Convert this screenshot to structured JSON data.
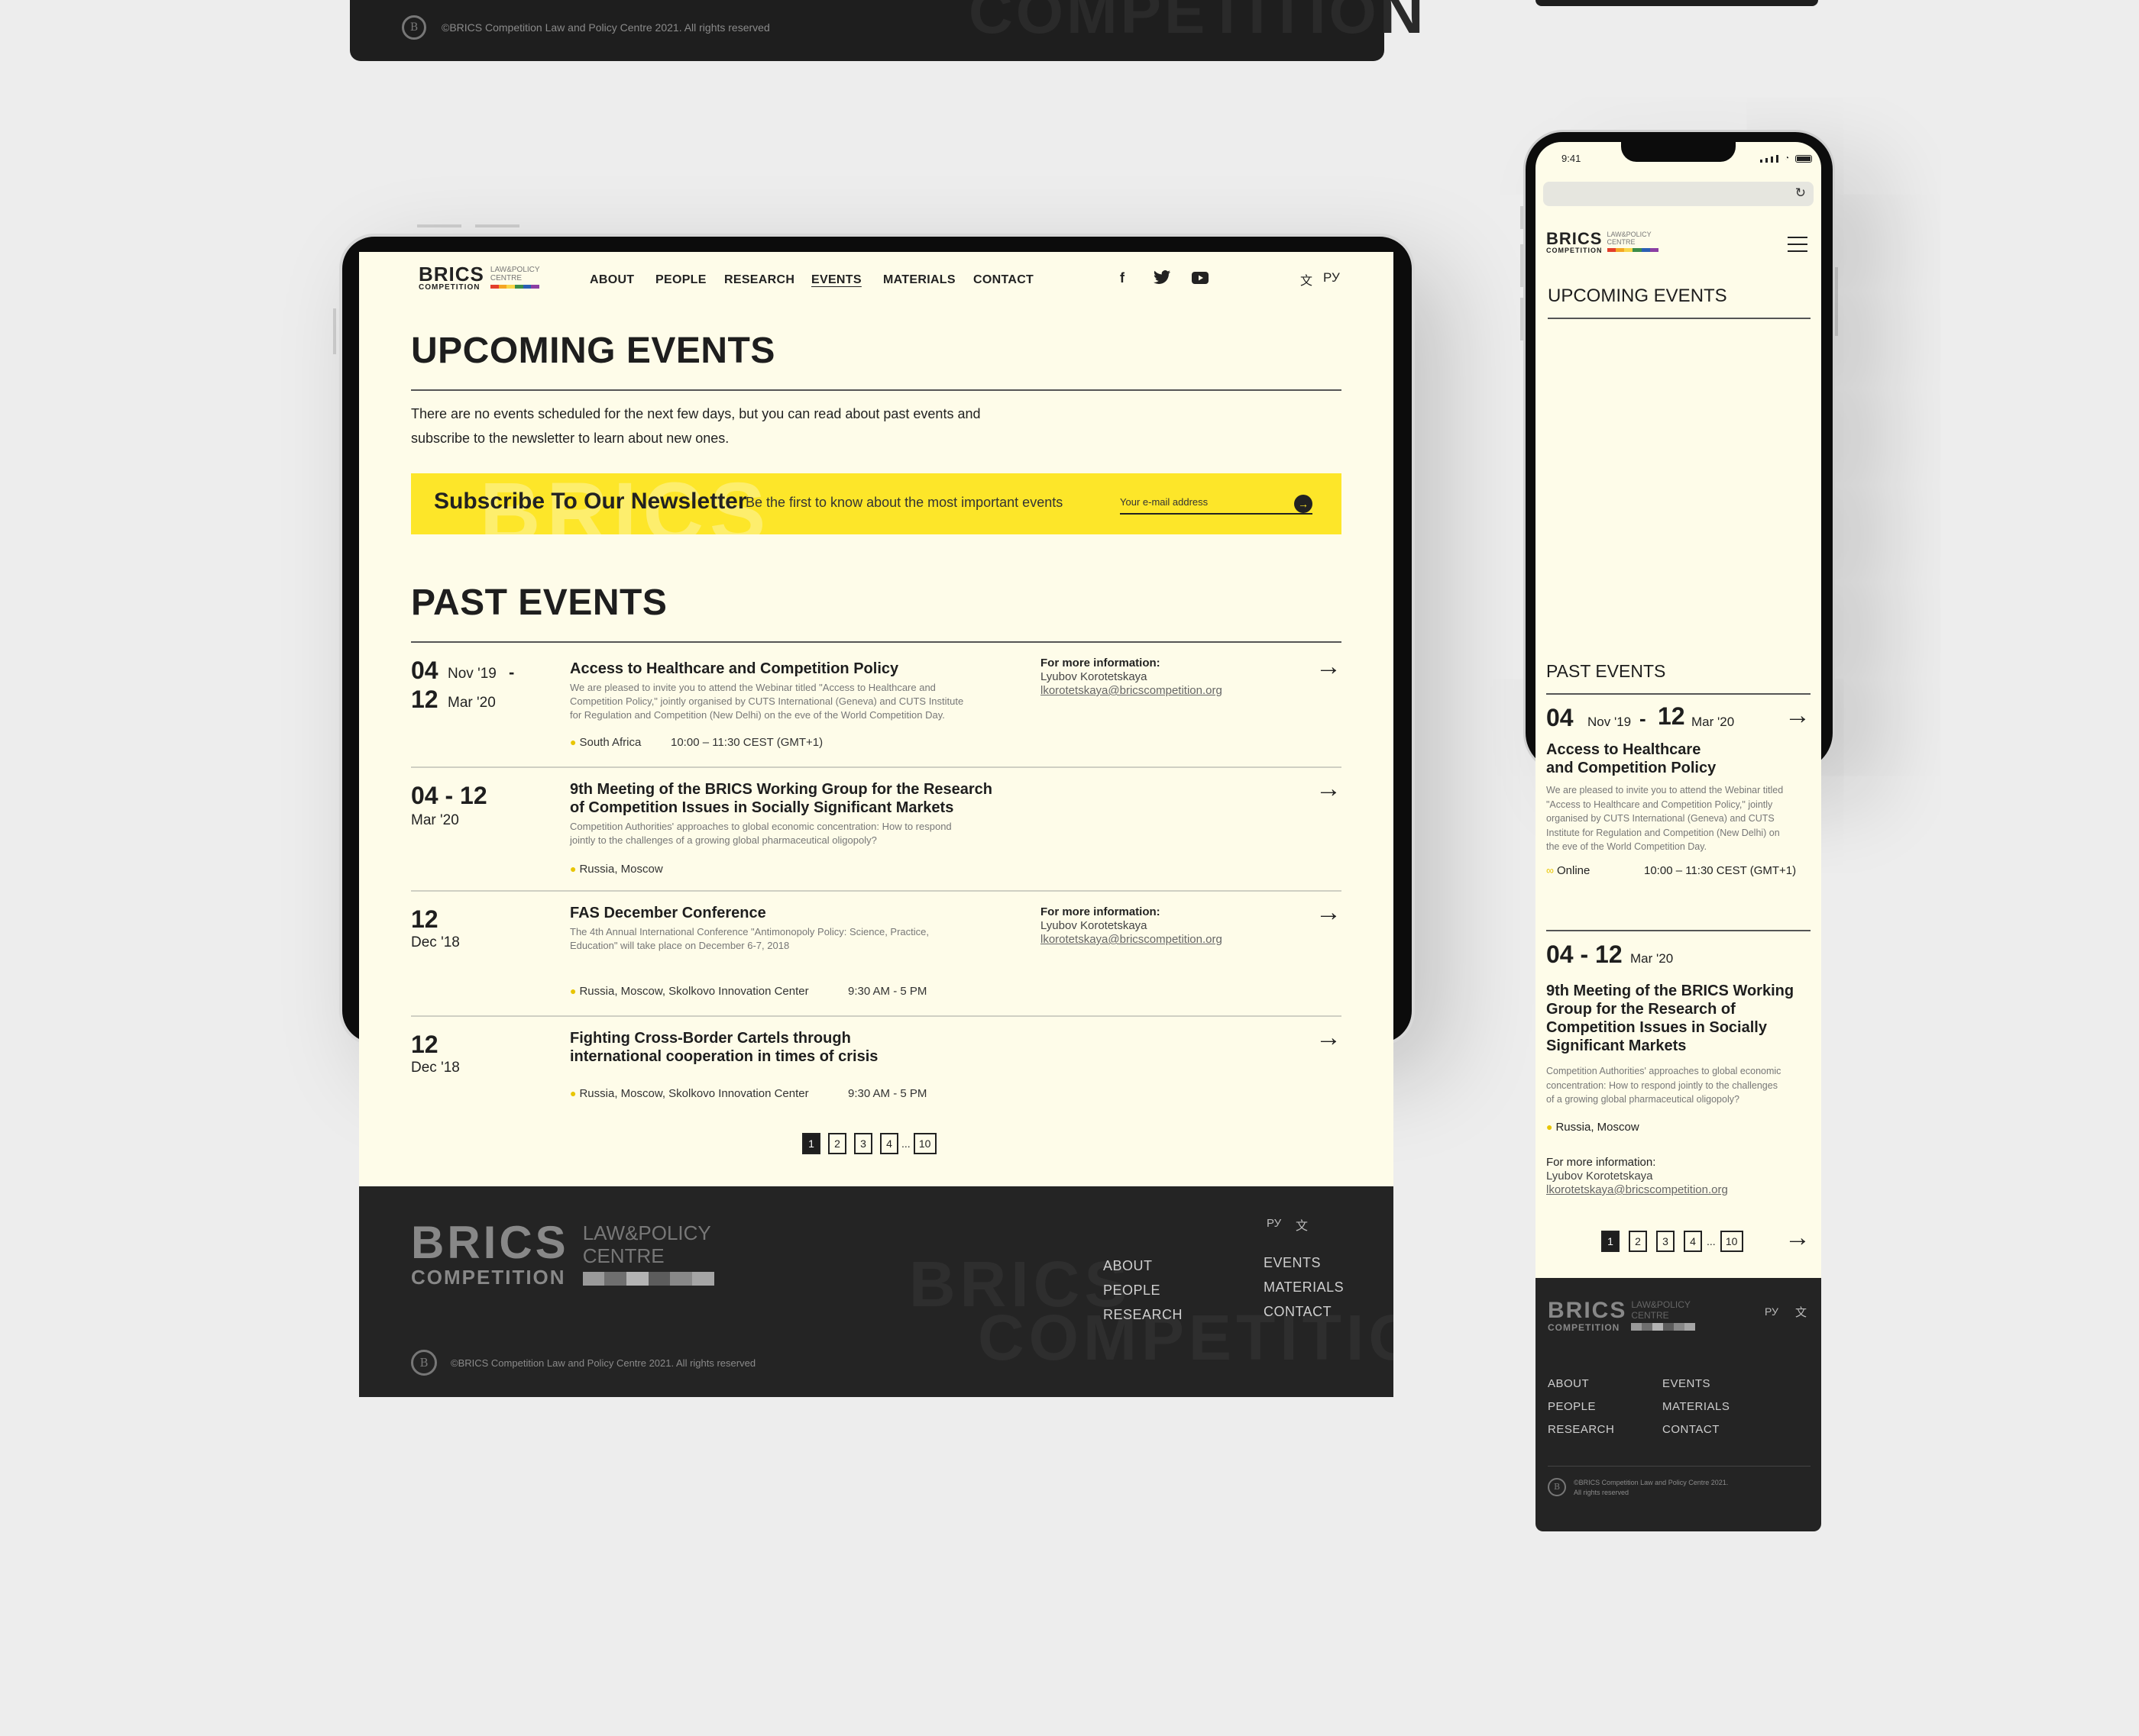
{
  "brand": {
    "name": "BRICS",
    "sub": "COMPETITION",
    "centre": [
      "LAW&POLICY",
      "CENTRE"
    ],
    "stripe_colors": [
      "#e33e2b",
      "#f5a623",
      "#f8d648",
      "#3b8c4a",
      "#2b5fb4",
      "#8b3fa3"
    ],
    "accent": "#fde629",
    "cream": "#fefce9",
    "dark": "#242424"
  },
  "nav": {
    "items": [
      "ABOUT",
      "PEOPLE",
      "RESEARCH",
      "EVENTS",
      "MATERIALS",
      "CONTACT"
    ],
    "active": "EVENTS",
    "lang": "РУ",
    "lang_icon": "文"
  },
  "upcoming": {
    "title": "UPCOMING EVENTS",
    "intro_line1": "There are no events scheduled for the next few days, but you can read about past events and",
    "intro_line2": "subscribe to the newsletter to learn about new ones."
  },
  "newsletter": {
    "watermark": "BRICS",
    "title": "Subscribe To Our Newsletter",
    "subtitle": "Be the first to know about the most important events",
    "placeholder": "Your e-mail address"
  },
  "past": {
    "title": "PAST EVENTS",
    "events": [
      {
        "day1": "04",
        "mon1": "Nov '19",
        "dash": "-",
        "day2": "12",
        "mon2": "Mar '20",
        "title": "Access to Healthcare and Competition Policy",
        "desc1": "We are pleased to invite you to attend the Webinar titled \"Access to Healthcare and",
        "desc2": "Competition Policy,\" jointly organised by CUTS International (Geneva) and CUTS Institute",
        "desc3": "for Regulation and Competition (New Delhi) on the eve of the World Competition Day.",
        "location": "South Africa",
        "time": "10:00 – 11:30 CEST (GMT+1)",
        "info_label": "For more information:",
        "info_name": "Lyubov Korotetskaya",
        "info_mail": "lkorotetskaya@bricscompetition.org"
      },
      {
        "range": "04 - 12",
        "mon": "Mar '20",
        "title1": "9th Meeting of the BRICS Working Group for the Research",
        "title2": "of Competition Issues in Socially Significant Markets",
        "desc1": "Competition Authorities' approaches to global economic concentration: How to respond",
        "desc2": "jointly to the challenges of a growing global pharmaceutical oligopoly?",
        "location": "Russia, Moscow"
      },
      {
        "day": "12",
        "mon": "Dec '18",
        "title": "FAS December Conference",
        "desc1": "The 4th Annual International Conference \"Antimonopoly Policy: Science, Practice,",
        "desc2": "Education\" will take place on December 6-7, 2018",
        "location": "Russia, Moscow, Skolkovo Innovation Center",
        "time": "9:30 AM - 5 PM",
        "info_label": "For more information:",
        "info_name": "Lyubov Korotetskaya",
        "info_mail": "lkorotetskaya@bricscompetition.org"
      },
      {
        "day": "12",
        "mon": "Dec '18",
        "title1": "Fighting Cross-Border Cartels through",
        "title2": "international cooperation in times of crisis",
        "location": "Russia, Moscow, Skolkovo Innovation Center",
        "time": "9:30 AM - 5 PM"
      }
    ],
    "pages": [
      "1",
      "2",
      "3",
      "4",
      "10"
    ],
    "ellipsis": "...",
    "current_page": "1"
  },
  "footer": {
    "links_col1": [
      "ABOUT",
      "PEOPLE",
      "RESEARCH"
    ],
    "links_col2": [
      "EVENTS",
      "MATERIALS",
      "CONTACT"
    ],
    "lang": "РУ",
    "lang_icon": "文",
    "watermark1": "BRICS",
    "watermark2": "COMPETITION",
    "copyright": "©BRICS Competition Law and Policy Centre 2021. All rights reserved",
    "copyright_line1": "©BRICS Competition Law and Policy Centre 2021.",
    "copyright_line2": "All rights reserved",
    "seal": "B"
  },
  "phone": {
    "time": "9:41",
    "upcoming_title": "UPCOMING EVENTS",
    "past_title": "PAST EVENTS",
    "event1": {
      "day1": "04",
      "mon1": "Nov '19",
      "dash": "-",
      "day2": "12",
      "mon2": "Mar '20",
      "title1": "Access to Healthcare",
      "title2": "and Competition Policy",
      "desc": [
        "We are pleased to invite you to attend the Webinar titled",
        "\"Access to Healthcare and Competition Policy,\" jointly",
        "organised by CUTS International (Geneva) and CUTS",
        "Institute for Regulation and Competition (New Delhi) on",
        "the eve of the World Competition Day."
      ],
      "location": "Online",
      "time": "10:00 – 11:30 CEST (GMT+1)"
    },
    "event2": {
      "range": "04 - 12",
      "mon": "Mar '20",
      "title": [
        "9th Meeting of the BRICS Working",
        "Group for the Research of",
        "Competition Issues in Socially",
        "Significant Markets"
      ],
      "desc": [
        "Competition Authorities' approaches to global economic",
        "concentration: How to respond jointly to the challenges",
        "of a growing global pharmaceutical oligopoly?"
      ],
      "location": "Russia, Moscow",
      "info_label": "For more information:",
      "info_name": "Lyubov Korotetskaya",
      "info_mail": "lkorotetskaya@bricscompetition.org"
    }
  }
}
